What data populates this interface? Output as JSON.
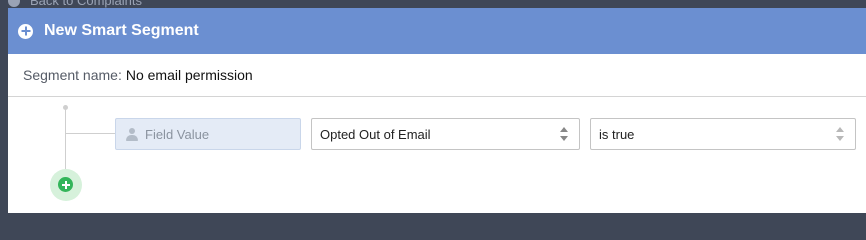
{
  "backdrop": {
    "link_text": "Back to Complaints"
  },
  "modal": {
    "title": "New Smart Segment",
    "header_icon": "plus-circle-icon",
    "accent_color": "#6b8fd1"
  },
  "segment_name": {
    "label": "Segment name:",
    "value": "No email permission"
  },
  "condition": {
    "source_label": "Field Value",
    "source_icon": "person-icon",
    "field_selected": "Opted Out of Email",
    "operator_selected": "is true"
  },
  "add_condition": {
    "icon": "plus-circle-icon",
    "color": "#33b55a"
  }
}
